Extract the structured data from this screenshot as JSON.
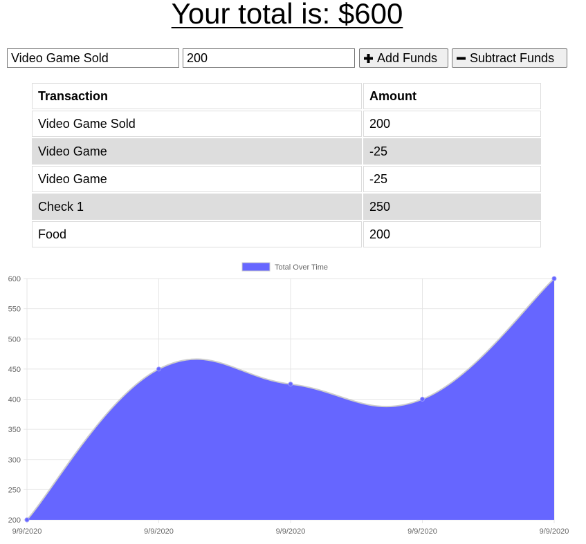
{
  "header": {
    "title": "Your total is: $600"
  },
  "form": {
    "name_value": "Video Game Sold",
    "amount_value": "200",
    "add_label": "Add Funds",
    "subtract_label": "Subtract Funds",
    "add_icon": "plus-icon",
    "subtract_icon": "minus-icon"
  },
  "table": {
    "headers": [
      "Transaction",
      "Amount"
    ],
    "rows": [
      {
        "name": "Video Game Sold",
        "amount": "200"
      },
      {
        "name": "Video Game",
        "amount": "-25"
      },
      {
        "name": "Video Game",
        "amount": "-25"
      },
      {
        "name": "Check 1",
        "amount": "250"
      },
      {
        "name": "Food",
        "amount": "200"
      }
    ],
    "alt_row_color": "#dddddd"
  },
  "chart_data": {
    "type": "area",
    "x": [
      "9/9/2020",
      "9/9/2020",
      "9/9/2020",
      "9/9/2020",
      "9/9/2020"
    ],
    "series": [
      {
        "name": "Total Over Time",
        "values": [
          200,
          450,
          425,
          400,
          600
        ],
        "color": "#6666ff"
      }
    ],
    "ylim": [
      200,
      600
    ],
    "yticks": [
      200,
      250,
      300,
      350,
      400,
      450,
      500,
      550,
      600
    ],
    "legend": "top-center",
    "grid": true,
    "title": "",
    "xlabel": "",
    "ylabel": ""
  }
}
